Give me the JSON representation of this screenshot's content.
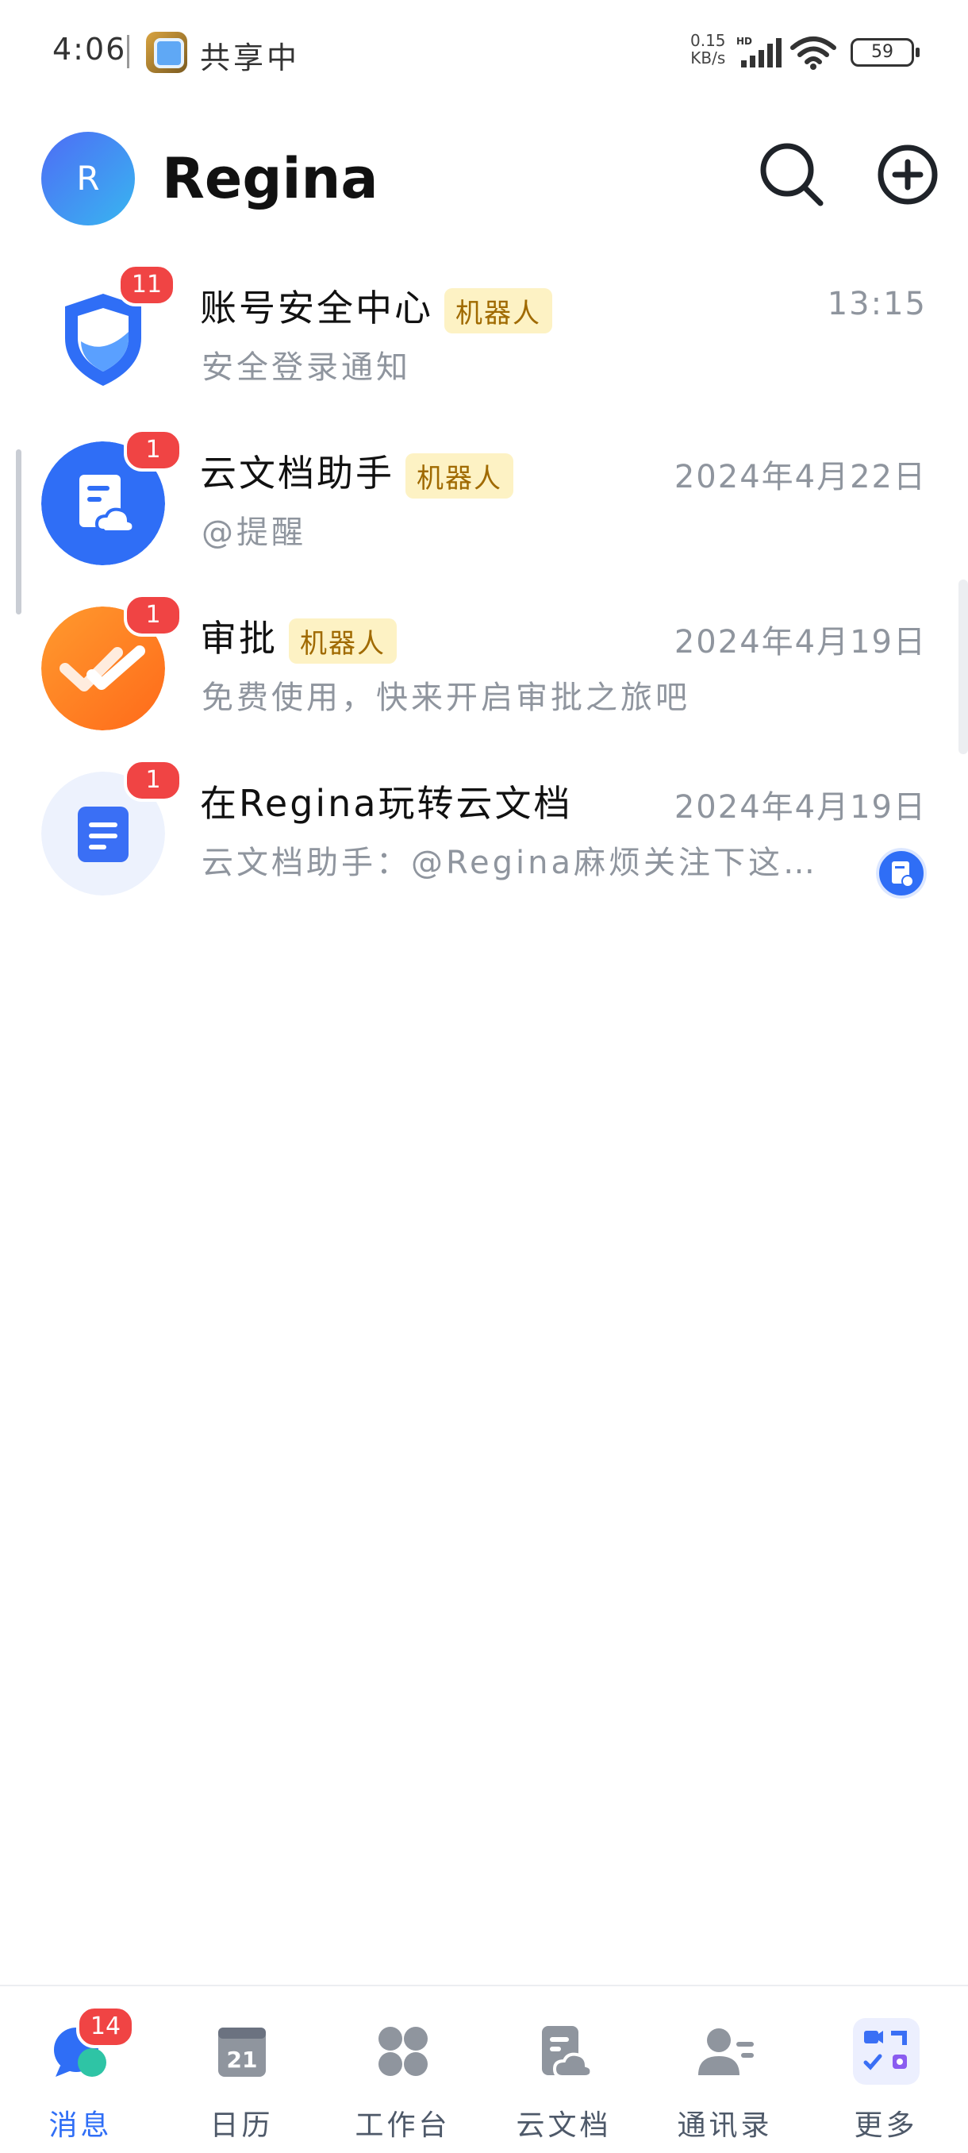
{
  "status_bar": {
    "time": "4:06",
    "sharing_label": "共享中",
    "net_speed_value": "0.15",
    "net_speed_unit": "KB/s",
    "hd_label": "HD",
    "battery": "59"
  },
  "header": {
    "avatar_letter": "R",
    "title": "Regina",
    "search_icon": "search-icon",
    "add_icon": "add-circle-icon"
  },
  "chats": [
    {
      "name": "账号安全中心",
      "tag": "机器人",
      "time": "13:15",
      "preview": "安全登录通知",
      "badge": "11",
      "icon": "shield-icon",
      "accent": "#2f6ef6"
    },
    {
      "name": "云文档助手",
      "tag": "机器人",
      "time": "2024年4月22日",
      "preview": "@提醒",
      "badge": "1",
      "icon": "cloud-doc-icon",
      "accent": "#2f6ef6"
    },
    {
      "name": "审批",
      "tag": "机器人",
      "time": "2024年4月19日",
      "preview": "免费使用，快来开启审批之旅吧",
      "badge": "1",
      "icon": "approval-icon",
      "accent": "#ff7a1a"
    },
    {
      "name": "在Regina玩转云文档",
      "tag": "",
      "time": "2024年4月19日",
      "preview": "云文档助手：@Regina麻烦关注下这篇…",
      "badge": "1",
      "icon": "document-icon",
      "accent": "#3a6ff5"
    }
  ],
  "nav": {
    "messages": {
      "label": "消息",
      "badge": "14"
    },
    "calendar": {
      "label": "日历",
      "date": "21"
    },
    "workbench": {
      "label": "工作台"
    },
    "docs": {
      "label": "云文档"
    },
    "contacts": {
      "label": "通讯录"
    },
    "more": {
      "label": "更多"
    }
  },
  "colors": {
    "primary": "#2f6ef6",
    "badge_red": "#f04444",
    "robot_tag_bg": "#fdf2c4",
    "robot_tag_text": "#a06a00",
    "secondary_text": "#8f959e"
  }
}
